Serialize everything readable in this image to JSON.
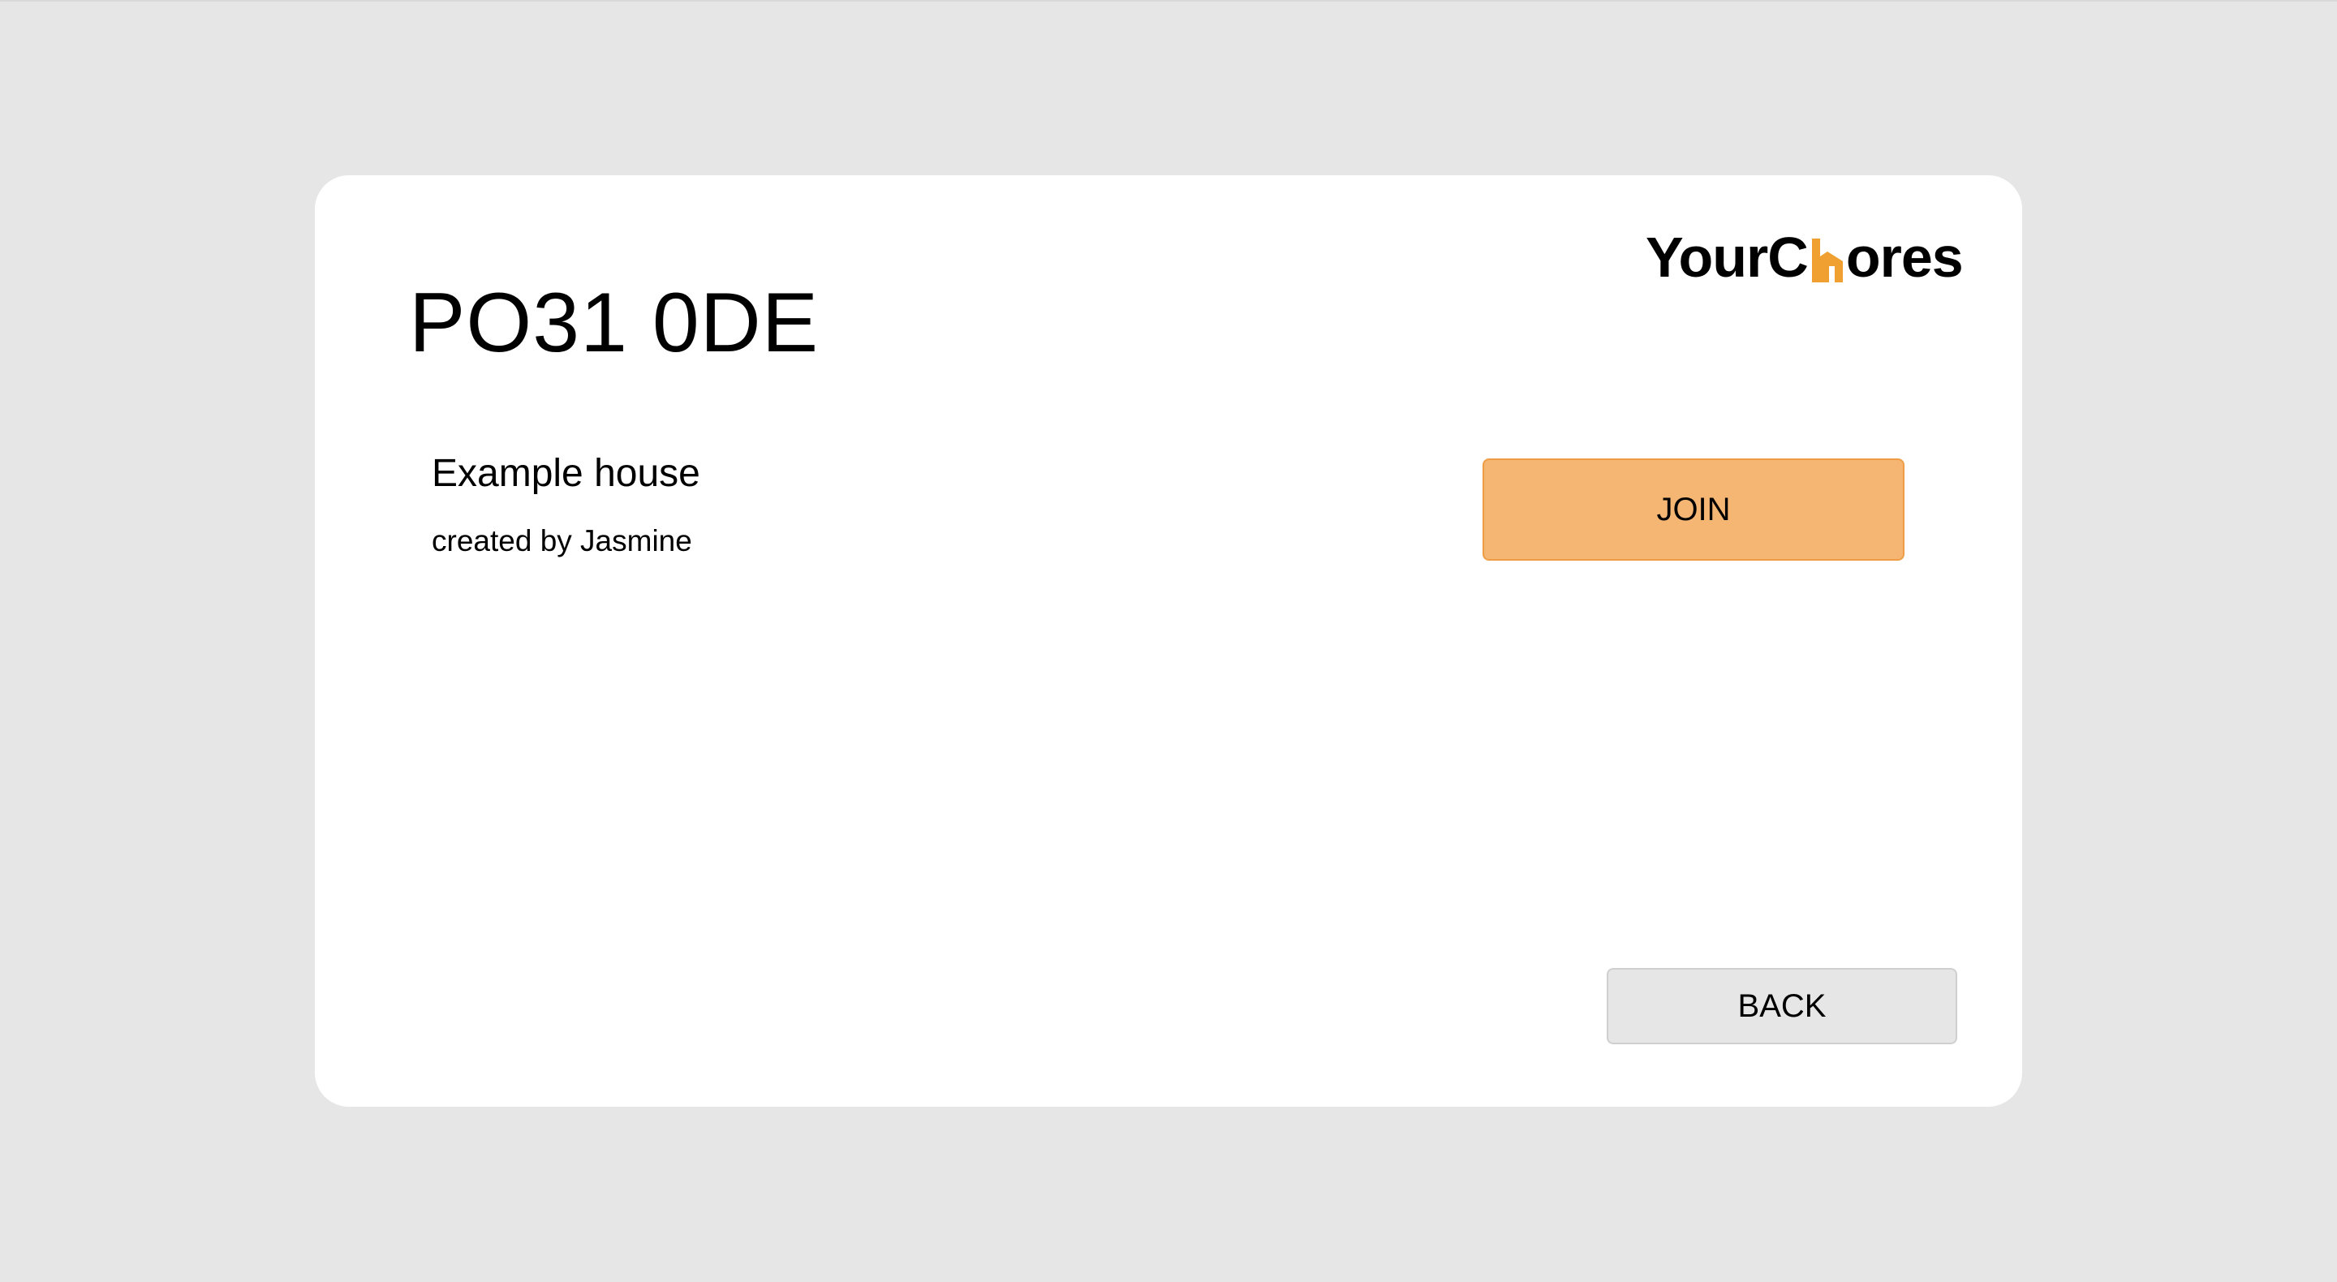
{
  "logo": {
    "text_before": "YourC",
    "icon": "house-icon",
    "text_after": "ores",
    "accent_color": "#f0a030"
  },
  "postcode": "PO31 0DE",
  "house": {
    "name": "Example house",
    "created_by": "created by Jasmine"
  },
  "actions": {
    "join_label": "JOIN",
    "back_label": "BACK"
  },
  "colors": {
    "background": "#e6e6e6",
    "card": "#ffffff",
    "join_button": "#f5b673",
    "join_border": "#ef9d45",
    "back_button": "#e6e6e6"
  }
}
